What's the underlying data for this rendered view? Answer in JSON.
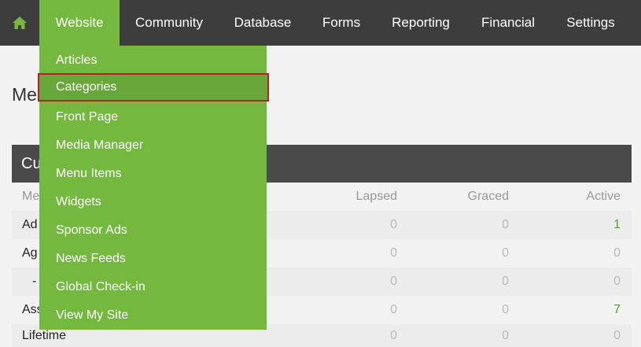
{
  "nav": {
    "home_icon": "home-icon",
    "items": [
      {
        "label": "Website"
      },
      {
        "label": "Community"
      },
      {
        "label": "Database"
      },
      {
        "label": "Forms"
      },
      {
        "label": "Reporting"
      },
      {
        "label": "Financial"
      },
      {
        "label": "Settings"
      }
    ]
  },
  "page": {
    "title": "Me"
  },
  "panel": {
    "title": "Cu"
  },
  "table": {
    "header": {
      "label": "Me",
      "lapsed": "Lapsed",
      "graced": "Graced",
      "active": "Active"
    },
    "rows": [
      {
        "label": "Ad",
        "lapsed": "0",
        "graced": "0",
        "active": "1"
      },
      {
        "label": "Ag",
        "lapsed": "0",
        "graced": "0",
        "active": "0"
      },
      {
        "label": "-",
        "lapsed": "0",
        "graced": "0",
        "active": "0"
      },
      {
        "label": "Ass",
        "lapsed": "0",
        "graced": "0",
        "active": "7"
      },
      {
        "label": "Lifetime",
        "lapsed": "0",
        "graced": "0",
        "active": "0"
      }
    ]
  },
  "dropdown": {
    "items": [
      {
        "label": "Articles"
      },
      {
        "label": "Categories"
      },
      {
        "label": "Front Page"
      },
      {
        "label": "Media Manager"
      },
      {
        "label": "Menu Items"
      },
      {
        "label": "Widgets"
      },
      {
        "label": "Sponsor Ads"
      },
      {
        "label": "News Feeds"
      },
      {
        "label": "Global Check-in"
      },
      {
        "label": "View My Site"
      }
    ]
  },
  "colors": {
    "nav_bg": "#3d3d3d",
    "accent_green": "#74b83f",
    "highlight_border": "#b72025",
    "active_value_green": "#5aa02c"
  }
}
